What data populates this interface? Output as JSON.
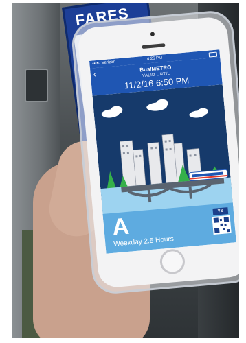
{
  "scene": {
    "sign_text": "FARES"
  },
  "phone": {
    "status_bar": {
      "carrier": "••••○ Verizon",
      "time": "4:26 PM"
    },
    "header": {
      "back_icon": "chevron-left-icon",
      "title": "Bus/METRO",
      "valid_label": "VALID UNTIL",
      "valid_date": "11/2/16 6:50 PM"
    },
    "pass": {
      "letter": "A",
      "type": "Weekday 2.5 Hours",
      "badge": "YS",
      "code_icon": "qr-code-icon"
    }
  },
  "colors": {
    "header_blue": "#1f56b3",
    "sky_navy": "#163a6b",
    "panel_blue": "#5eabe0"
  }
}
